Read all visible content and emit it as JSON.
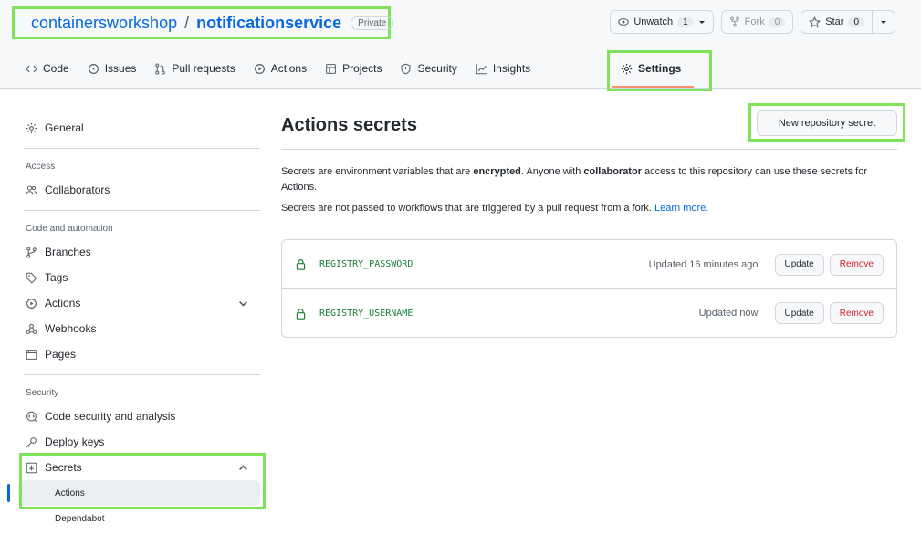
{
  "repo": {
    "owner": "containersworkshop",
    "separator": "/",
    "name": "notificationservice",
    "visibility": "Private"
  },
  "actions": {
    "unwatch_label": "Unwatch",
    "unwatch_count": "1",
    "fork_label": "Fork",
    "fork_count": "0",
    "star_label": "Star",
    "star_count": "0"
  },
  "tabs": [
    {
      "label": "Code",
      "icon": "code-icon"
    },
    {
      "label": "Issues",
      "icon": "issue-icon"
    },
    {
      "label": "Pull requests",
      "icon": "pull-request-icon"
    },
    {
      "label": "Actions",
      "icon": "play-icon"
    },
    {
      "label": "Projects",
      "icon": "table-icon"
    },
    {
      "label": "Security",
      "icon": "shield-icon"
    },
    {
      "label": "Insights",
      "icon": "graph-icon"
    },
    {
      "label": "Settings",
      "icon": "gear-icon"
    }
  ],
  "sidebar": {
    "general": "General",
    "access_heading": "Access",
    "collaborators": "Collaborators",
    "code_heading": "Code and automation",
    "branches": "Branches",
    "tags": "Tags",
    "actions": "Actions",
    "webhooks": "Webhooks",
    "pages": "Pages",
    "security_heading": "Security",
    "code_security": "Code security and analysis",
    "deploy_keys": "Deploy keys",
    "secrets": "Secrets",
    "secrets_actions": "Actions",
    "secrets_dependabot": "Dependabot"
  },
  "main": {
    "title": "Actions secrets",
    "new_secret_label": "New repository secret",
    "desc_part1": "Secrets are environment variables that are ",
    "desc_bold1": "encrypted",
    "desc_part2": ". Anyone with ",
    "desc_bold2": "collaborator",
    "desc_part3": " access to this repository can use these secrets for Actions.",
    "desc2_text": "Secrets are not passed to workflows that are triggered by a pull request from a fork. ",
    "learn_more": "Learn more."
  },
  "secrets": [
    {
      "name": "REGISTRY_PASSWORD",
      "updated": "Updated 16 minutes ago",
      "update_label": "Update",
      "remove_label": "Remove"
    },
    {
      "name": "REGISTRY_USERNAME",
      "updated": "Updated now",
      "update_label": "Update",
      "remove_label": "Remove"
    }
  ],
  "colors": {
    "highlight": "#7ee35a",
    "link": "#0969da",
    "secret_name": "#1a7f37",
    "remove": "#cf222e"
  }
}
